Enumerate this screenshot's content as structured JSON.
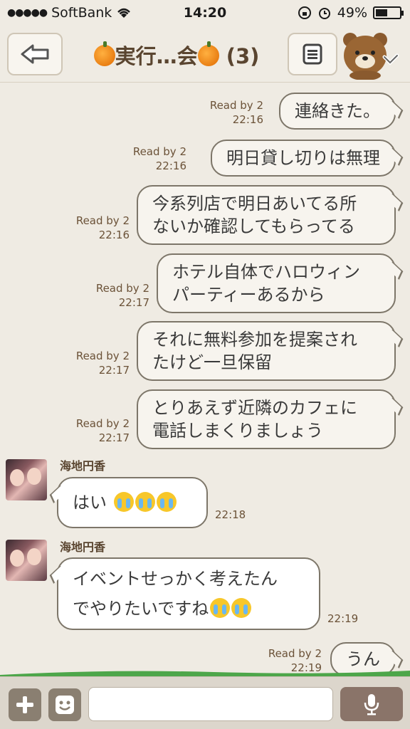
{
  "status": {
    "carrier": "SoftBank",
    "time": "14:20",
    "battery": "49%"
  },
  "header": {
    "title_left": "実行…会",
    "title_count": "(3)"
  },
  "outgoing": [
    {
      "meta_read": "Read by 2",
      "meta_time": "22:16",
      "lines": [
        "連絡きた。"
      ]
    },
    {
      "meta_read": "Read by 2",
      "meta_time": "22:16",
      "lines": [
        "明日貸し切りは無理"
      ]
    },
    {
      "meta_read": "Read by 2",
      "meta_time": "22:16",
      "lines": [
        "今系列店で明日あいてる所",
        "ないか確認してもらってる"
      ]
    },
    {
      "meta_read": "Read by 2",
      "meta_time": "22:17",
      "lines": [
        "ホテル自体でハロウィン",
        "パーティーあるから"
      ]
    },
    {
      "meta_read": "Read by 2",
      "meta_time": "22:17",
      "lines": [
        "それに無料参加を提案され",
        "たけど一旦保留"
      ]
    },
    {
      "meta_read": "Read by 2",
      "meta_time": "22:17",
      "lines": [
        "とりあえず近隣のカフェに",
        "電話しまくりましょう"
      ]
    },
    {
      "meta_read": "Read by 2",
      "meta_time": "22:19",
      "lines": [
        "うん"
      ]
    }
  ],
  "incoming": [
    {
      "sender": "海地円香",
      "lines": [
        "はい"
      ],
      "time": "22:18"
    },
    {
      "sender": "海地円香",
      "lines": [
        "イベントせっかく考えたん",
        "でやりたいですね"
      ],
      "time": "22:19"
    }
  ],
  "icons": {
    "back": "back-arrow-icon",
    "menu": "menu-icon",
    "profile": "brown-bear-icon",
    "plus": "plus-icon",
    "sticker": "sticker-icon",
    "mic": "microphone-icon",
    "emoji": "crying-face-emoji"
  },
  "colors": {
    "background": "#efebe3",
    "bubble_border": "#7d7669",
    "meta_text": "#6b5238"
  }
}
